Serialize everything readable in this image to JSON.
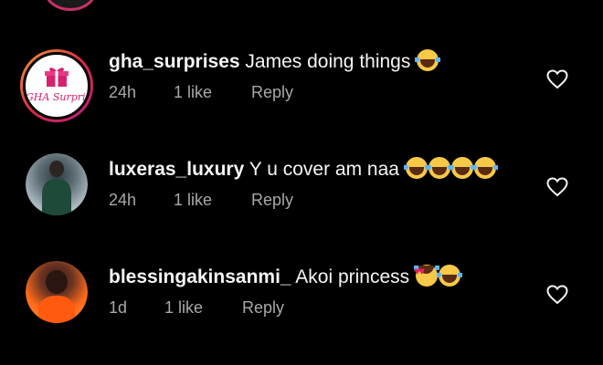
{
  "comments": [
    {
      "username": "gha_surprises",
      "text": "James doing things",
      "emojis": [
        "laughing-tears"
      ],
      "time": "24h",
      "likes": "1 like",
      "reply": "Reply",
      "avatar": {
        "type": "logo",
        "logo_text": "GHA Surprises",
        "story_ring": true
      }
    },
    {
      "username": "luxeras_luxury",
      "text": "Y u cover am naa",
      "emojis": [
        "laughing-tears",
        "laughing-tears",
        "laughing-tears",
        "laughing-tears"
      ],
      "time": "24h",
      "likes": "1 like",
      "reply": "Reply",
      "avatar": {
        "type": "photo"
      }
    },
    {
      "username": "blessingakinsanmi_",
      "text": "Akoi princess",
      "emojis": [
        "heart-eyes",
        "laughing-tears"
      ],
      "time": "1d",
      "likes": "1 like",
      "reply": "Reply",
      "avatar": {
        "type": "photo"
      }
    }
  ],
  "colors": {
    "background": "#000000",
    "text": "#f5f5f5",
    "meta": "#a8a8a8",
    "brand_pink": "#d6226e"
  }
}
